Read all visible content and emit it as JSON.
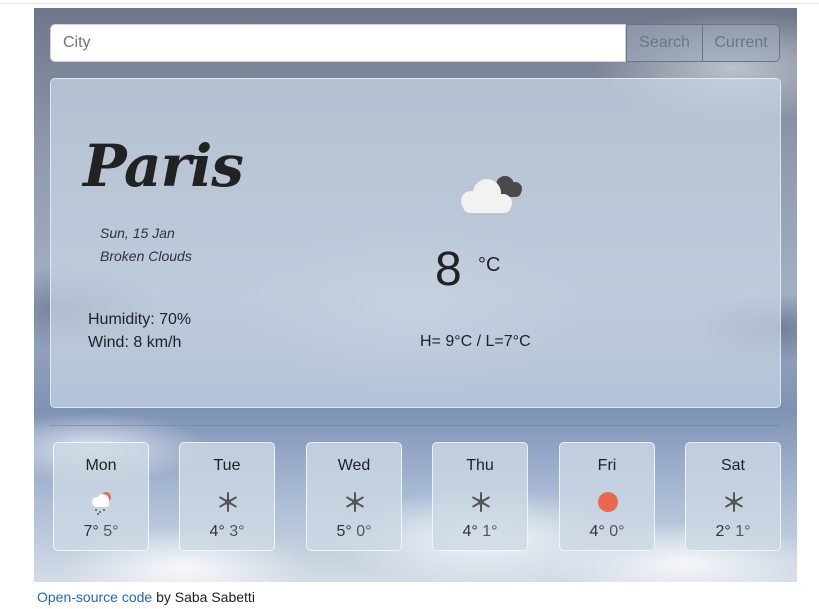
{
  "search": {
    "placeholder": "City",
    "value": "",
    "search_label": "Search",
    "current_label": "Current"
  },
  "current": {
    "city": "Paris",
    "date": "Sun, 15 Jan",
    "description": "Broken Clouds",
    "humidity": "Humidity: 70%",
    "wind": "Wind: 8 km/h",
    "temperature": "8",
    "unit": "°C",
    "high_low": "H= 9°C / L=7°C",
    "icon": "broken-clouds-icon"
  },
  "forecast": [
    {
      "day": "Mon",
      "high": "7°",
      "low": "5°",
      "icon": "snow-cloud-sun-icon"
    },
    {
      "day": "Tue",
      "high": "4°",
      "low": "3°",
      "icon": "snowflake-icon"
    },
    {
      "day": "Wed",
      "high": "5°",
      "low": "0°",
      "icon": "snowflake-icon"
    },
    {
      "day": "Thu",
      "high": "4°",
      "low": "1°",
      "icon": "snowflake-icon"
    },
    {
      "day": "Fri",
      "high": "4°",
      "low": "0°",
      "icon": "sun-icon"
    },
    {
      "day": "Sat",
      "high": "2°",
      "low": "1°",
      "icon": "snowflake-icon"
    }
  ],
  "footer": {
    "link_text": "Open-source code",
    "by_text": " by Saba Sabetti"
  },
  "colors": {
    "sun": "#e8694f",
    "link": "#2266cc",
    "button_border": "#6c757d"
  }
}
